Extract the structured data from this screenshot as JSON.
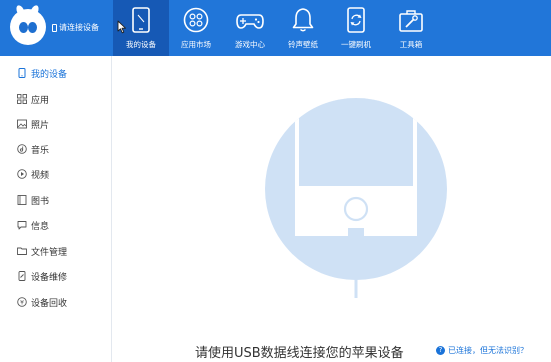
{
  "header": {
    "connect_status": "请连接设备",
    "nav": [
      {
        "label": "我的设备",
        "icon": "phone-icon"
      },
      {
        "label": "应用市场",
        "icon": "app-grid-icon"
      },
      {
        "label": "游戏中心",
        "icon": "gamepad-icon"
      },
      {
        "label": "铃声壁纸",
        "icon": "bell-icon"
      },
      {
        "label": "一键刷机",
        "icon": "flash-refresh-icon"
      },
      {
        "label": "工具箱",
        "icon": "toolbox-icon"
      }
    ]
  },
  "sidebar": {
    "items": [
      {
        "label": "我的设备",
        "icon": "device-icon"
      },
      {
        "label": "应用",
        "icon": "apps-icon"
      },
      {
        "label": "照片",
        "icon": "photo-icon"
      },
      {
        "label": "音乐",
        "icon": "music-icon"
      },
      {
        "label": "视频",
        "icon": "video-icon"
      },
      {
        "label": "图书",
        "icon": "book-icon"
      },
      {
        "label": "信息",
        "icon": "message-icon"
      },
      {
        "label": "文件管理",
        "icon": "folder-icon"
      },
      {
        "label": "设备维修",
        "icon": "repair-icon"
      },
      {
        "label": "设备回收",
        "icon": "recycle-icon"
      }
    ]
  },
  "main": {
    "hint": "请使用USB数据线连接您的苹果设备",
    "help_link": "已连接，但无法识别？"
  },
  "colors": {
    "topbar": "#2176d9",
    "topbar_active": "#1659b5",
    "accent": "#1a73d9",
    "illustration": "#cfe1f5"
  }
}
